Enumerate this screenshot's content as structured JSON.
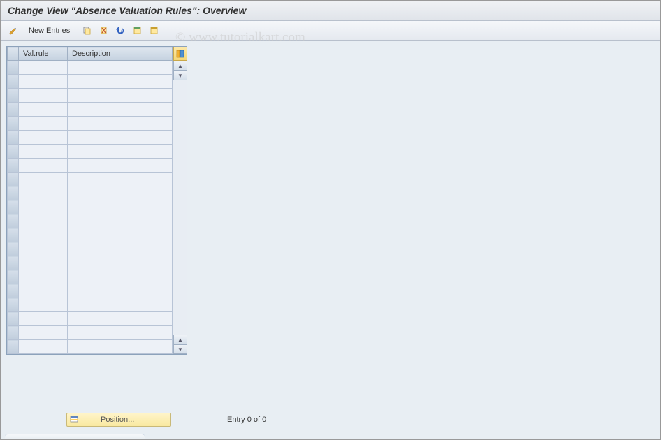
{
  "title": "Change View \"Absence Valuation Rules\": Overview",
  "toolbar": {
    "new_entries_label": "New Entries"
  },
  "table": {
    "columns": {
      "val_rule": "Val.rule",
      "description": "Description"
    },
    "row_count": 21
  },
  "footer": {
    "position_label": "Position...",
    "entry_status": "Entry 0 of 0"
  },
  "watermark": "© www.tutorialkart.com"
}
